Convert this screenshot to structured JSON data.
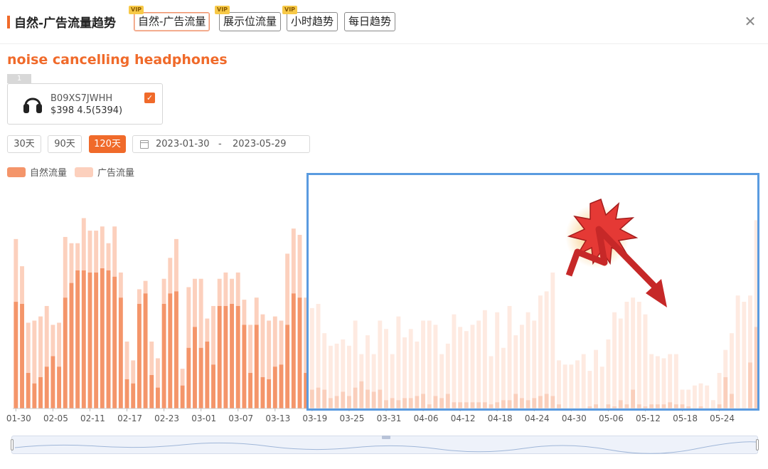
{
  "header": {
    "title": "自然-广告流量趋势",
    "tabs": [
      {
        "label": "自然-广告流量",
        "vip": "VIP",
        "active": true
      },
      {
        "label": "展示位流量",
        "vip": "VIP",
        "active": false
      },
      {
        "label": "小时趋势",
        "vip": "VIP",
        "active": false
      },
      {
        "label": "每日趋势",
        "vip": "",
        "active": false
      }
    ],
    "close_icon": "close-icon"
  },
  "keyword": "noise cancelling headphones",
  "product": {
    "index": "1",
    "asin": "B09XS7JWHH",
    "info": "$398 4.5(5394)",
    "checked": true,
    "image_icon": "headphones-icon"
  },
  "range": {
    "buttons": [
      {
        "label": "30天",
        "active": false
      },
      {
        "label": "90天",
        "active": false
      },
      {
        "label": "120天",
        "active": true
      }
    ],
    "start": "2023-01-30",
    "separator": "-",
    "end": "2023-05-29"
  },
  "legend": [
    {
      "label": "自然流量",
      "color": "#f4956a"
    },
    {
      "label": "广告流量",
      "color": "#fcd0bd"
    }
  ],
  "chart_data": {
    "type": "bar",
    "stacked": true,
    "x_tick_labels": [
      "01-30",
      "02-05",
      "02-11",
      "02-17",
      "02-23",
      "03-01",
      "03-07",
      "03-13",
      "03-19",
      "03-25",
      "03-31",
      "04-06",
      "04-12",
      "04-18",
      "04-24",
      "04-30",
      "05-06",
      "05-12",
      "05-18",
      "05-24"
    ],
    "series": [
      {
        "name": "自然流量",
        "color": "#f4956a",
        "values": [
          0.51,
          0.5,
          0.17,
          0.12,
          0.15,
          0.2,
          0.25,
          0.2,
          0.53,
          0.6,
          0.66,
          0.66,
          0.65,
          0.65,
          0.67,
          0.66,
          0.63,
          0.53,
          0.14,
          0.12,
          0.5,
          0.55,
          0.16,
          0.1,
          0.5,
          0.55,
          0.56,
          0.11,
          0.29,
          0.39,
          0.29,
          0.32,
          0.21,
          0.49,
          0.49,
          0.5,
          0.49,
          0.4,
          0.17,
          0.4,
          0.15,
          0.14,
          0.2,
          0.21,
          0.4,
          0.55,
          0.53,
          0.17,
          0.09,
          0.1,
          0.09,
          0.05,
          0.06,
          0.08,
          0.06,
          0.1,
          0.13,
          0.09,
          0.08,
          0.09,
          0.04,
          0.05,
          0.04,
          0.05,
          0.05,
          0.06,
          0.07,
          0.02,
          0.06,
          0.05,
          0.07,
          0.03,
          0.03,
          0.03,
          0.03,
          0.03,
          0.03,
          0.02,
          0.03,
          0.04,
          0.04,
          0.07,
          0.05,
          0.04,
          0.05,
          0.06,
          0.07,
          0.06,
          0.02,
          0.0,
          0.0,
          0.0,
          0.0,
          0.01,
          0.02,
          0.0,
          0.02,
          0.01,
          0.04,
          0.02,
          0.09,
          0.02,
          0.01,
          0.02,
          0.02,
          0.02,
          0.03,
          0.02,
          0.02,
          0.01,
          0.0,
          0.01,
          0.0,
          0.0,
          0.02,
          0.15,
          0.07,
          0.0,
          0.0,
          0.22,
          0.39
        ]
      },
      {
        "name": "广告流量",
        "color": "#fcd0bd",
        "values": [
          0.3,
          0.18,
          0.24,
          0.3,
          0.29,
          0.29,
          0.15,
          0.21,
          0.29,
          0.19,
          0.13,
          0.25,
          0.2,
          0.2,
          0.2,
          0.13,
          0.24,
          0.12,
          0.18,
          0.11,
          0.07,
          0.06,
          0.16,
          0.14,
          0.12,
          0.17,
          0.25,
          0.08,
          0.29,
          0.23,
          0.33,
          0.11,
          0.28,
          0.13,
          0.16,
          0.12,
          0.16,
          0.12,
          0.23,
          0.13,
          0.3,
          0.28,
          0.24,
          0.21,
          0.34,
          0.31,
          0.3,
          0.36,
          0.39,
          0.4,
          0.27,
          0.25,
          0.25,
          0.25,
          0.24,
          0.32,
          0.13,
          0.26,
          0.18,
          0.33,
          0.34,
          0.21,
          0.4,
          0.29,
          0.33,
          0.26,
          0.35,
          0.4,
          0.34,
          0.21,
          0.24,
          0.42,
          0.36,
          0.34,
          0.37,
          0.39,
          0.44,
          0.23,
          0.43,
          0.25,
          0.45,
          0.28,
          0.35,
          0.42,
          0.37,
          0.48,
          0.49,
          0.59,
          0.21,
          0.21,
          0.21,
          0.23,
          0.26,
          0.17,
          0.26,
          0.2,
          0.31,
          0.45,
          0.39,
          0.49,
          0.44,
          0.49,
          0.44,
          0.24,
          0.23,
          0.22,
          0.23,
          0.24,
          0.07,
          0.08,
          0.11,
          0.11,
          0.11,
          0.04,
          0.15,
          0.13,
          0.29,
          0.54,
          0.51,
          0.32,
          0.51
        ]
      }
    ],
    "ylim": [
      0,
      1
    ],
    "grid": false
  },
  "overlay": {
    "highlight_color": "#5a9be0",
    "arrow_color": "#e53935"
  }
}
